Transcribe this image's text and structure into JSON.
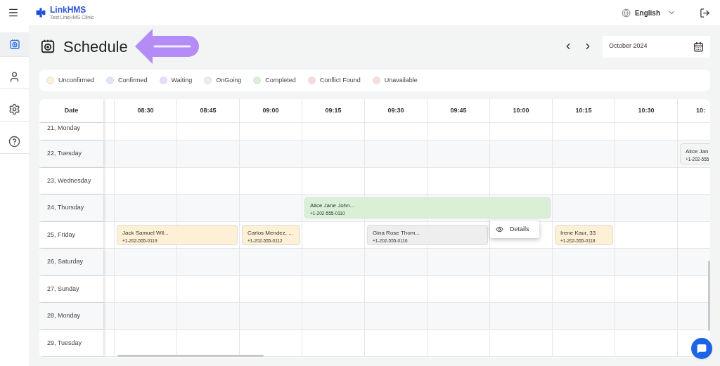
{
  "header": {
    "brand": "LinkHMS",
    "clinic": "Test LinkHMS Clinic",
    "language": "English"
  },
  "sidebar": {
    "items": [
      {
        "kind": "schedule",
        "selected": true
      },
      {
        "kind": "user",
        "selected": false
      },
      {
        "kind": "settings",
        "selected": false
      },
      {
        "kind": "help",
        "selected": false
      }
    ]
  },
  "page": {
    "title": "Schedule",
    "month": "October 2024"
  },
  "legend": [
    {
      "label": "Unconfirmed",
      "color": "#fdf0d5"
    },
    {
      "label": "Confirmed",
      "color": "#dbe7f7"
    },
    {
      "label": "Waiting",
      "color": "#e6dcfb"
    },
    {
      "label": "OnGoing",
      "color": "#eeeeee"
    },
    {
      "label": "Completed",
      "color": "#d9f0d6"
    },
    {
      "label": "Conflict Found",
      "color": "#fbd9d9"
    },
    {
      "label": "Unavailable",
      "color": "#fbdcdc"
    }
  ],
  "table": {
    "date_heading": "Date",
    "columns": [
      "08:30",
      "08:45",
      "09:00",
      "09:15",
      "09:30",
      "09:45",
      "10:00",
      "10:15",
      "10:30",
      "10:"
    ],
    "rows": [
      {
        "date": "21, Monday"
      },
      {
        "date": "22, Tuesday",
        "cells": [
          {
            "kind": "empty"
          },
          {
            "kind": "empty"
          },
          {
            "kind": "empty"
          },
          {
            "kind": "empty"
          },
          {
            "kind": "empty"
          },
          {
            "kind": "empty"
          },
          {
            "kind": "empty"
          },
          {
            "kind": "empty"
          },
          {
            "kind": "empty"
          },
          {
            "kind": "appointment",
            "name": "Alice Jan",
            "phone": "+1-202-555",
            "color": "#f3f4f4"
          }
        ]
      },
      {
        "date": "23, Wednesday"
      },
      {
        "date": "24, Thursday",
        "cells": [
          {
            "kind": "empty"
          },
          {
            "kind": "empty"
          },
          {
            "kind": "empty"
          },
          {
            "kind": "appointment",
            "name": "Alice Jane John...",
            "phone": "+1-202-555-0110",
            "color": "#d9f0d6"
          },
          {
            "kind": "covered"
          },
          {
            "kind": "covered"
          },
          {
            "kind": "covered"
          },
          {
            "kind": "empty"
          },
          {
            "kind": "empty"
          },
          {
            "kind": "empty"
          }
        ]
      },
      {
        "date": "25, Friday",
        "cells": [
          {
            "kind": "appointment",
            "name": "Jack Samuel Wil...",
            "phone": "+1-202-555-0119",
            "color": "#fdf0d5"
          },
          {
            "kind": "covered"
          },
          {
            "kind": "appointment",
            "name": "Carlos Mendez, ...",
            "phone": "+1-202-555-0112",
            "color": "#fdf0d5"
          },
          {
            "kind": "empty"
          },
          {
            "kind": "appointment",
            "name": "Gina Rose Thom...",
            "phone": "+1-202-555-0116",
            "color": "#eeeeee"
          },
          {
            "kind": "covered"
          },
          {
            "kind": "empty"
          },
          {
            "kind": "appointment",
            "name": "Irene Kaur, 33",
            "phone": "+1-202-555-0118",
            "color": "#fdf0d5"
          },
          {
            "kind": "empty"
          },
          {
            "kind": "empty"
          }
        ]
      },
      {
        "date": "26, Saturday"
      },
      {
        "date": "27, Sunday"
      },
      {
        "date": "28, Monday"
      },
      {
        "date": "29, Tuesday"
      }
    ]
  },
  "context_menu": {
    "items": [
      {
        "label": "Details"
      }
    ]
  }
}
